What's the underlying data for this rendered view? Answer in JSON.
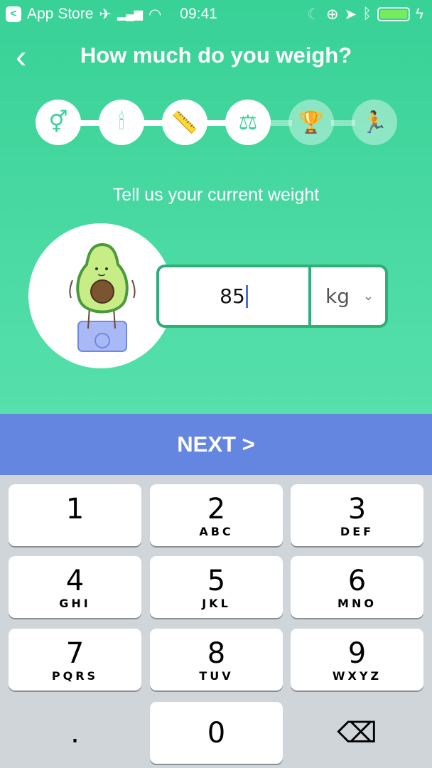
{
  "status_bar": {
    "back_app": "App Store",
    "time": "09:41"
  },
  "header": {
    "title": "How much do you weigh?"
  },
  "steps": [
    {
      "icon": "gender-icon",
      "glyph": "⚥",
      "done": true
    },
    {
      "icon": "candle-icon",
      "glyph": "🕯",
      "done": true
    },
    {
      "icon": "ruler-icon",
      "glyph": "📏",
      "done": true
    },
    {
      "icon": "scale-icon",
      "glyph": "⚖",
      "done": true
    },
    {
      "icon": "trophy-icon",
      "glyph": "🏆",
      "done": false
    },
    {
      "icon": "running-icon",
      "glyph": "🏃",
      "done": false
    }
  ],
  "subtitle": "Tell us your current weight",
  "weight": {
    "value": "85",
    "unit": "kg"
  },
  "next_label": "NEXT >",
  "keypad": [
    {
      "n": "1",
      "l": ""
    },
    {
      "n": "2",
      "l": "ABC"
    },
    {
      "n": "3",
      "l": "DEF"
    },
    {
      "n": "4",
      "l": "GHI"
    },
    {
      "n": "5",
      "l": "JKL"
    },
    {
      "n": "6",
      "l": "MNO"
    },
    {
      "n": "7",
      "l": "PQRS"
    },
    {
      "n": "8",
      "l": "TUV"
    },
    {
      "n": "9",
      "l": "WXYZ"
    },
    {
      "n": ".",
      "l": ""
    },
    {
      "n": "0",
      "l": ""
    },
    {
      "n": "⌫",
      "l": ""
    }
  ],
  "colors": {
    "accent_green": "#38d196",
    "next_button": "#6586e0"
  }
}
